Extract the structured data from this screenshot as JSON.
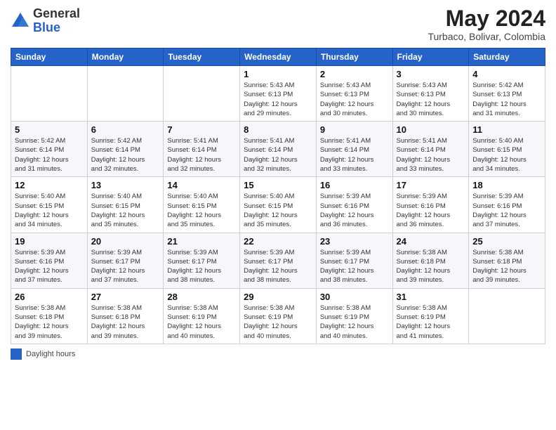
{
  "header": {
    "logo_general": "General",
    "logo_blue": "Blue",
    "month_title": "May 2024",
    "subtitle": "Turbaco, Bolivar, Colombia"
  },
  "weekdays": [
    "Sunday",
    "Monday",
    "Tuesday",
    "Wednesday",
    "Thursday",
    "Friday",
    "Saturday"
  ],
  "footer": {
    "daylight_label": "Daylight hours"
  },
  "weeks": [
    {
      "days": [
        {
          "num": "",
          "info": ""
        },
        {
          "num": "",
          "info": ""
        },
        {
          "num": "",
          "info": ""
        },
        {
          "num": "1",
          "info": "Sunrise: 5:43 AM\nSunset: 6:13 PM\nDaylight: 12 hours\nand 29 minutes."
        },
        {
          "num": "2",
          "info": "Sunrise: 5:43 AM\nSunset: 6:13 PM\nDaylight: 12 hours\nand 30 minutes."
        },
        {
          "num": "3",
          "info": "Sunrise: 5:43 AM\nSunset: 6:13 PM\nDaylight: 12 hours\nand 30 minutes."
        },
        {
          "num": "4",
          "info": "Sunrise: 5:42 AM\nSunset: 6:13 PM\nDaylight: 12 hours\nand 31 minutes."
        }
      ]
    },
    {
      "days": [
        {
          "num": "5",
          "info": "Sunrise: 5:42 AM\nSunset: 6:14 PM\nDaylight: 12 hours\nand 31 minutes."
        },
        {
          "num": "6",
          "info": "Sunrise: 5:42 AM\nSunset: 6:14 PM\nDaylight: 12 hours\nand 32 minutes."
        },
        {
          "num": "7",
          "info": "Sunrise: 5:41 AM\nSunset: 6:14 PM\nDaylight: 12 hours\nand 32 minutes."
        },
        {
          "num": "8",
          "info": "Sunrise: 5:41 AM\nSunset: 6:14 PM\nDaylight: 12 hours\nand 32 minutes."
        },
        {
          "num": "9",
          "info": "Sunrise: 5:41 AM\nSunset: 6:14 PM\nDaylight: 12 hours\nand 33 minutes."
        },
        {
          "num": "10",
          "info": "Sunrise: 5:41 AM\nSunset: 6:14 PM\nDaylight: 12 hours\nand 33 minutes."
        },
        {
          "num": "11",
          "info": "Sunrise: 5:40 AM\nSunset: 6:15 PM\nDaylight: 12 hours\nand 34 minutes."
        }
      ]
    },
    {
      "days": [
        {
          "num": "12",
          "info": "Sunrise: 5:40 AM\nSunset: 6:15 PM\nDaylight: 12 hours\nand 34 minutes."
        },
        {
          "num": "13",
          "info": "Sunrise: 5:40 AM\nSunset: 6:15 PM\nDaylight: 12 hours\nand 35 minutes."
        },
        {
          "num": "14",
          "info": "Sunrise: 5:40 AM\nSunset: 6:15 PM\nDaylight: 12 hours\nand 35 minutes."
        },
        {
          "num": "15",
          "info": "Sunrise: 5:40 AM\nSunset: 6:15 PM\nDaylight: 12 hours\nand 35 minutes."
        },
        {
          "num": "16",
          "info": "Sunrise: 5:39 AM\nSunset: 6:16 PM\nDaylight: 12 hours\nand 36 minutes."
        },
        {
          "num": "17",
          "info": "Sunrise: 5:39 AM\nSunset: 6:16 PM\nDaylight: 12 hours\nand 36 minutes."
        },
        {
          "num": "18",
          "info": "Sunrise: 5:39 AM\nSunset: 6:16 PM\nDaylight: 12 hours\nand 37 minutes."
        }
      ]
    },
    {
      "days": [
        {
          "num": "19",
          "info": "Sunrise: 5:39 AM\nSunset: 6:16 PM\nDaylight: 12 hours\nand 37 minutes."
        },
        {
          "num": "20",
          "info": "Sunrise: 5:39 AM\nSunset: 6:17 PM\nDaylight: 12 hours\nand 37 minutes."
        },
        {
          "num": "21",
          "info": "Sunrise: 5:39 AM\nSunset: 6:17 PM\nDaylight: 12 hours\nand 38 minutes."
        },
        {
          "num": "22",
          "info": "Sunrise: 5:39 AM\nSunset: 6:17 PM\nDaylight: 12 hours\nand 38 minutes."
        },
        {
          "num": "23",
          "info": "Sunrise: 5:39 AM\nSunset: 6:17 PM\nDaylight: 12 hours\nand 38 minutes."
        },
        {
          "num": "24",
          "info": "Sunrise: 5:38 AM\nSunset: 6:18 PM\nDaylight: 12 hours\nand 39 minutes."
        },
        {
          "num": "25",
          "info": "Sunrise: 5:38 AM\nSunset: 6:18 PM\nDaylight: 12 hours\nand 39 minutes."
        }
      ]
    },
    {
      "days": [
        {
          "num": "26",
          "info": "Sunrise: 5:38 AM\nSunset: 6:18 PM\nDaylight: 12 hours\nand 39 minutes."
        },
        {
          "num": "27",
          "info": "Sunrise: 5:38 AM\nSunset: 6:18 PM\nDaylight: 12 hours\nand 39 minutes."
        },
        {
          "num": "28",
          "info": "Sunrise: 5:38 AM\nSunset: 6:19 PM\nDaylight: 12 hours\nand 40 minutes."
        },
        {
          "num": "29",
          "info": "Sunrise: 5:38 AM\nSunset: 6:19 PM\nDaylight: 12 hours\nand 40 minutes."
        },
        {
          "num": "30",
          "info": "Sunrise: 5:38 AM\nSunset: 6:19 PM\nDaylight: 12 hours\nand 40 minutes."
        },
        {
          "num": "31",
          "info": "Sunrise: 5:38 AM\nSunset: 6:19 PM\nDaylight: 12 hours\nand 41 minutes."
        },
        {
          "num": "",
          "info": ""
        }
      ]
    }
  ]
}
